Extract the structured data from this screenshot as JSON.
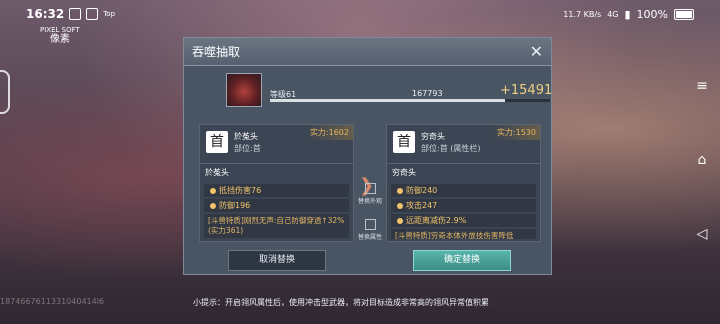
{
  "status_bar": {
    "time": "16:32",
    "mini_label": "Top",
    "net_speed": "11.7 KB/s",
    "network": "4G",
    "battery": "100%"
  },
  "watermark": {
    "line1": "PIXEL SOFT",
    "line2": "像素"
  },
  "dialog": {
    "title": "吞噬抽取",
    "close_label": "✕",
    "level_label": "等级61",
    "level_value": "167793",
    "level_gain": "+15491",
    "level_progress": 0.84,
    "left": {
      "name": "於菟头",
      "part": "部位:首",
      "power": "实力:1602",
      "sub_title": "於菟头",
      "attrs": [
        "抵挡伤害76",
        "防御196"
      ],
      "desc": "[斗兽特质]刚烈无声:自己防御穿透↑32%(实力361)"
    },
    "right": {
      "name": "穷奇头",
      "part": "部位:首 (属性栏)",
      "power": "实力:1530",
      "sub_title": "穷奇头",
      "attrs": [
        "防御240",
        "攻击247",
        "远距离减伤2.9%"
      ],
      "desc": "[斗兽特质]穷奇本体外放技伤害降低"
    },
    "replace_look_label": "替换外观",
    "replace_attr_label": "替换属性",
    "cancel_label": "取消替换",
    "confirm_label": "确定替换"
  },
  "tip": "小提示：开启翎风属性后，使用冲击型武器，将对目标造成非常高的翎风异常值积累",
  "uid": "1874667611331040414l6"
}
